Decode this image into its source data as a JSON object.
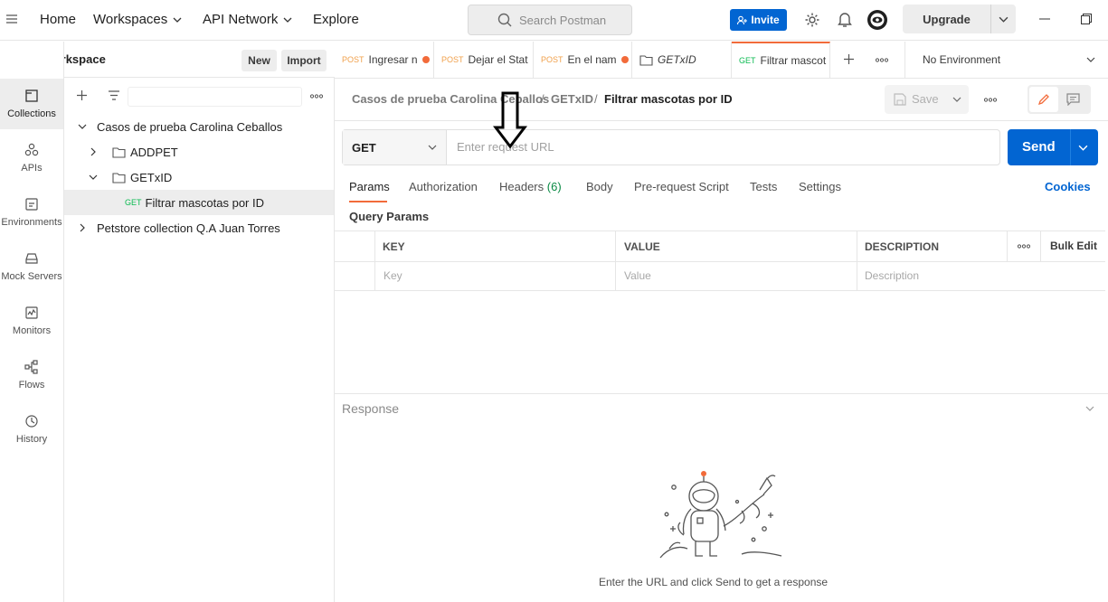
{
  "topbar": {
    "home": "Home",
    "workspaces": "Workspaces",
    "api_network": "API Network",
    "explore": "Explore",
    "search_placeholder": "Search Postman",
    "invite": "Invite",
    "upgrade": "Upgrade"
  },
  "workspace": {
    "name": "My Workspace",
    "new": "New",
    "import": "Import"
  },
  "rail": [
    {
      "label": "Collections",
      "icon": "collections-icon"
    },
    {
      "label": "APIs",
      "icon": "apis-icon"
    },
    {
      "label": "Environments",
      "icon": "environments-icon"
    },
    {
      "label": "Mock Servers",
      "icon": "mock-servers-icon"
    },
    {
      "label": "Monitors",
      "icon": "monitors-icon"
    },
    {
      "label": "Flows",
      "icon": "flows-icon"
    },
    {
      "label": "History",
      "icon": "history-icon"
    }
  ],
  "tree": {
    "collection1": "Casos de prueba Carolina Ceballos",
    "folder1": "ADDPET",
    "folder2": "GETxID",
    "request_method": "GET",
    "request_name": "Filtrar mascotas por ID",
    "collection2": "Petstore collection Q.A Juan Torres"
  },
  "tabs": [
    {
      "method": "POST",
      "name": "Ingresar n"
    },
    {
      "method": "POST",
      "name": "Dejar el Stat"
    },
    {
      "method": "POST",
      "name": "En el nam"
    },
    {
      "method": "",
      "name": "GETxID"
    },
    {
      "method": "GET",
      "name": "Filtrar mascot"
    }
  ],
  "environment": "No Environment",
  "breadcrumb": {
    "collection": "Casos de prueba Carolina Ceballos",
    "folder": "GETxID",
    "request": "Filtrar mascotas por ID",
    "sep": "/"
  },
  "save": "Save",
  "request": {
    "method": "GET",
    "url_placeholder": "Enter request URL",
    "send": "Send"
  },
  "subtabs": {
    "params": "Params",
    "authorization": "Authorization",
    "headers": "Headers",
    "headers_count": "(6)",
    "body": "Body",
    "prerequest": "Pre-request Script",
    "tests": "Tests",
    "settings": "Settings",
    "cookies": "Cookies"
  },
  "query_params": {
    "title": "Query Params",
    "col_key": "KEY",
    "col_value": "VALUE",
    "col_description": "DESCRIPTION",
    "bulk_edit": "Bulk Edit",
    "ph_key": "Key",
    "ph_value": "Value",
    "ph_description": "Description"
  },
  "response": {
    "title": "Response",
    "empty_message": "Enter the URL and click Send to get a response"
  },
  "colors": {
    "accent": "#0265d2",
    "post": "#f0a04b",
    "get": "#0cbb52",
    "unsaved_dot": "#f26b3a",
    "active_tab": "#f26b3a"
  }
}
